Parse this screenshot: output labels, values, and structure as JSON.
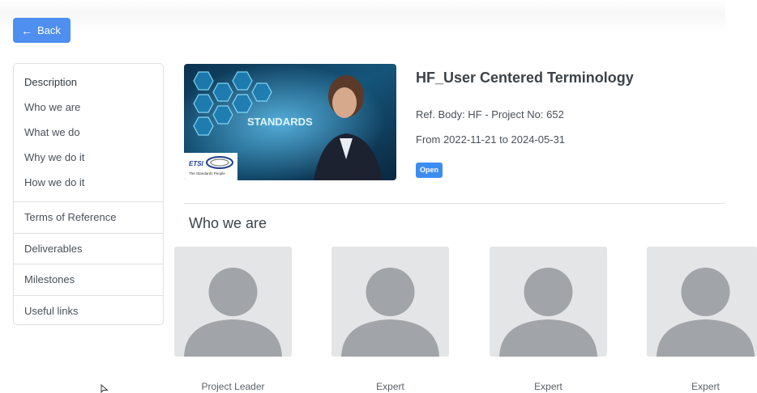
{
  "nav": {
    "back_label": "Back"
  },
  "sidebar": {
    "description": {
      "label": "Description",
      "items": [
        {
          "label": "Who we are"
        },
        {
          "label": "What we do"
        },
        {
          "label": "Why we do it"
        },
        {
          "label": "How we do it"
        }
      ]
    },
    "items": [
      {
        "label": "Terms of Reference"
      },
      {
        "label": "Deliverables"
      },
      {
        "label": "Milestones"
      },
      {
        "label": "Useful links"
      }
    ]
  },
  "banner": {
    "overlay_text": "STANDARDS",
    "logo_text": "ETSI",
    "logo_tagline": "The Standards People"
  },
  "project": {
    "title": "HF_User Centered Terminology",
    "ref": "Ref. Body: HF - Project No: 652",
    "dates": "From 2022-11-21 to 2024-05-31",
    "status": "Open"
  },
  "team": {
    "heading": "Who we are",
    "members": [
      {
        "role": "Project Leader"
      },
      {
        "role": "Expert"
      },
      {
        "role": "Expert"
      },
      {
        "role": "Expert"
      }
    ]
  },
  "colors": {
    "primary": "#4e8ff0",
    "badge": "#3c8df0",
    "avatar_bg": "#e4e5e7",
    "avatar_fg": "#a1a4a8"
  }
}
